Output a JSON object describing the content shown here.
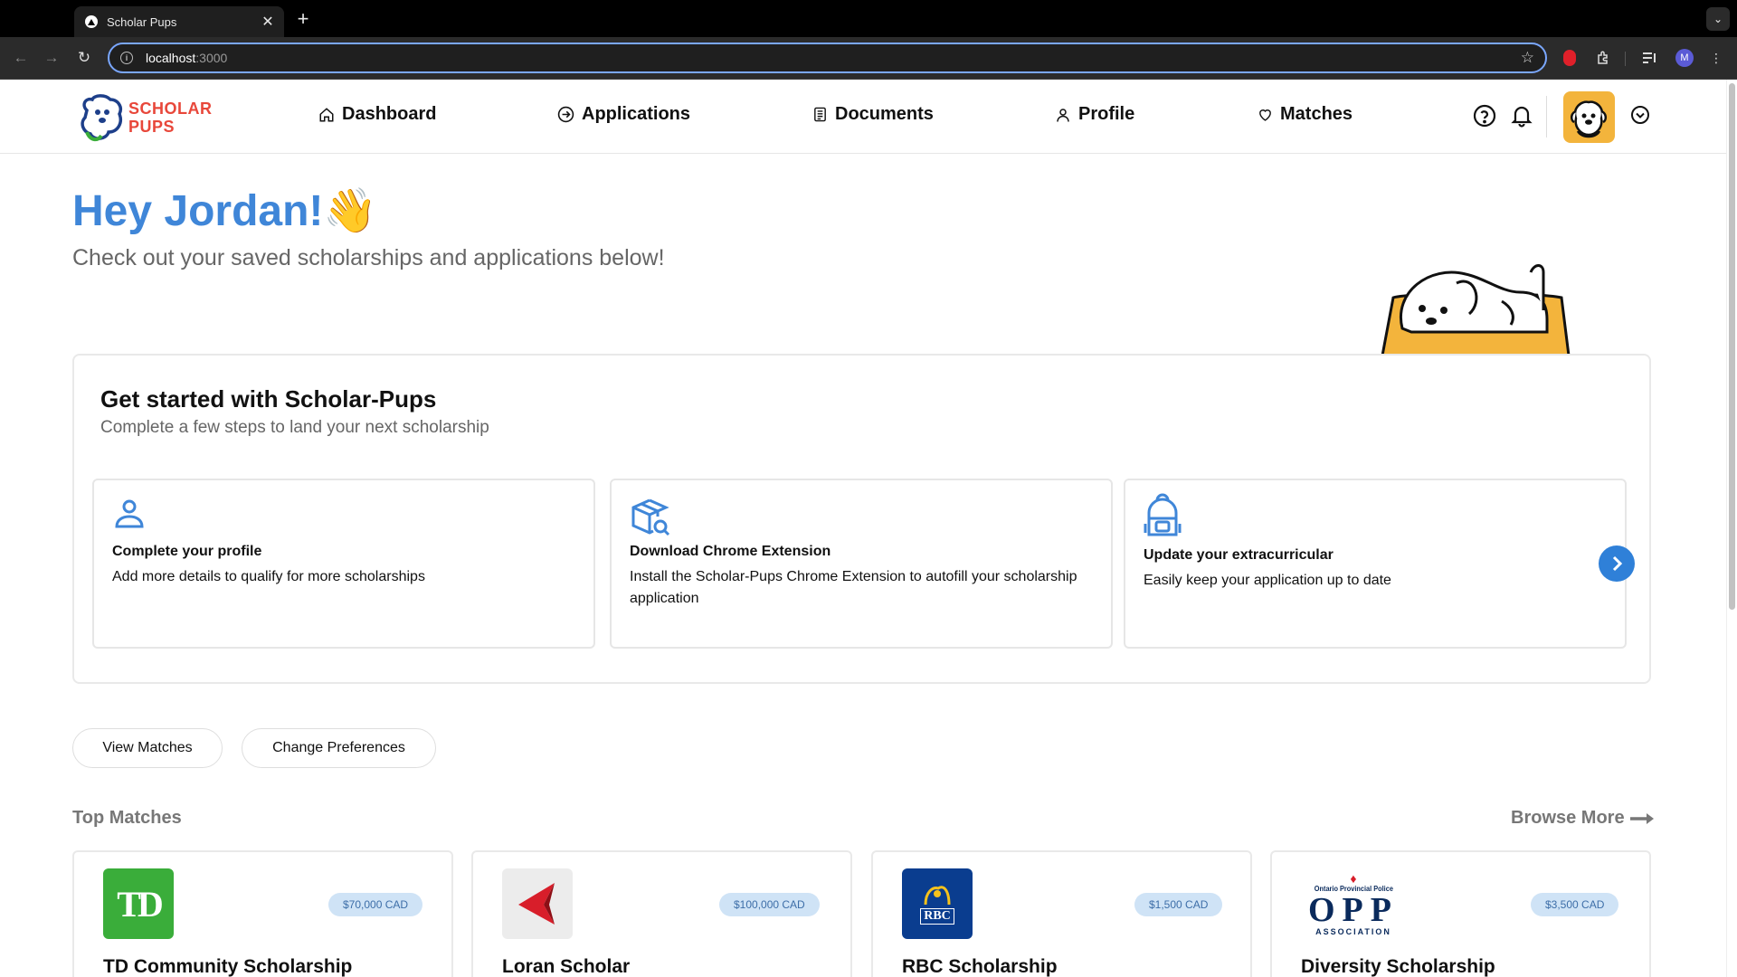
{
  "browser": {
    "tab_title": "Scholar Pups",
    "new_tab": "+",
    "url_host": "localhost",
    "url_port": ":3000",
    "profile_initial": "M"
  },
  "header": {
    "logo_line1": "SCHOLAR",
    "logo_line2": "PUPS",
    "nav": {
      "dashboard": "Dashboard",
      "applications": "Applications",
      "documents": "Documents",
      "profile": "Profile",
      "matches": "Matches"
    }
  },
  "hero": {
    "greeting": "Hey Jordan!👋",
    "subtitle": "Check out your saved scholarships and applications below!"
  },
  "get_started": {
    "title": "Get started with Scholar-Pups",
    "subtitle": "Complete a few steps to land your next scholarship",
    "steps": [
      {
        "title": "Complete your profile",
        "desc": "Add more details to qualify for more scholarships"
      },
      {
        "title": "Download Chrome Extension",
        "desc": "Install the Scholar-Pups Chrome Extension to autofill your scholarship application"
      },
      {
        "title": "Update your extracurricular",
        "desc": "Easily keep your application up to date"
      }
    ]
  },
  "actions": {
    "view_matches": "View Matches",
    "change_preferences": "Change Preferences"
  },
  "top_matches": {
    "title": "Top Matches",
    "browse_more": "Browse More",
    "cards": [
      {
        "name": "TD Community Scholarship",
        "amount": "$70,000 CAD",
        "logo_text": "TD"
      },
      {
        "name": "Loran Scholar",
        "amount": "$100,000 CAD"
      },
      {
        "name": "RBC Scholarship",
        "amount": "$1,500 CAD",
        "logo_text": "RBC"
      },
      {
        "name": "Diversity Scholarship",
        "amount": "$3,500 CAD",
        "logo_top": "Ontario Provincial Police",
        "logo_mid": "OPP",
        "logo_bottom": "ASSOCIATION"
      }
    ]
  },
  "colors": {
    "brand_red": "#e8473a",
    "accent_blue": "#3f86d8",
    "amount_badge_bg": "#cfe3f6",
    "td_green": "#3aad3a",
    "rbc_blue": "#0a3d8f",
    "loran_red": "#d81e2a"
  }
}
